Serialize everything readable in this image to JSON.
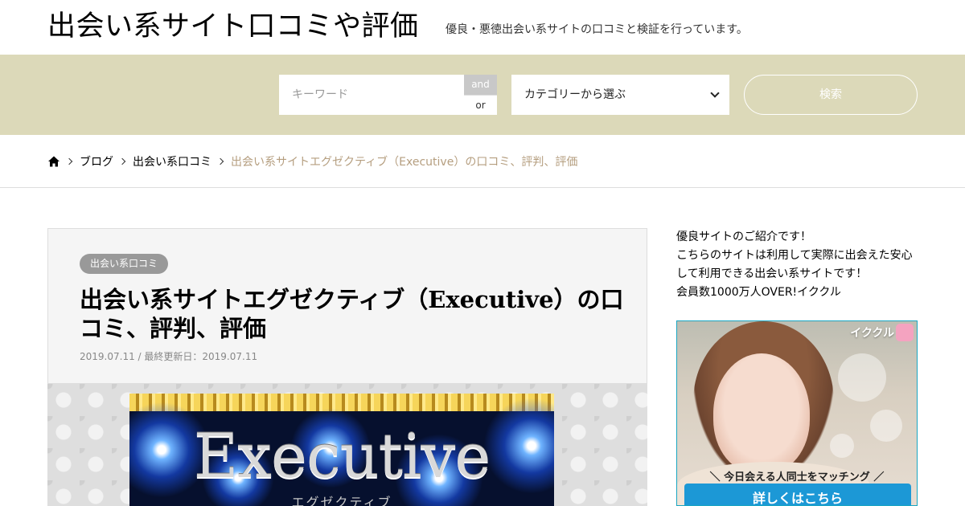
{
  "header": {
    "site_title": "出会い系サイト口コミや評価",
    "site_description": "優良・悪徳出会い系サイトの口コミと検証を行っています。"
  },
  "search": {
    "keyword_placeholder": "キーワード",
    "and_label": "and",
    "or_label": "or",
    "category_selected": "カテゴリーから選ぶ",
    "submit_label": "検索"
  },
  "breadcrumb": {
    "home_icon": "home-icon",
    "items": [
      "ブログ",
      "出会い系口コミ"
    ],
    "current": "出会い系サイトエグゼクティブ（Executive）の口コミ、評判、評価"
  },
  "article": {
    "category": "出会い系口コミ",
    "title": "出会い系サイトエグゼクティブ（Executive）の口コミ、評判、評価",
    "meta": "2019.07.11 / 最終更新日：2019.07.11",
    "featured_word": "Executive",
    "featured_sub": "エグゼクティブ"
  },
  "sidebar": {
    "intro_lines": [
      "優良サイトのご紹介です！",
      "こちらのサイトは利用して実際に出会えた安心",
      "して利用できる出会い系サイトです！",
      "会員数1000万人OVER!イククル"
    ],
    "ad": {
      "logo": "イククル",
      "tagline": "＼ 今日会える人同士をマッチング ／",
      "cta": "詳しくはこちら"
    }
  },
  "colors": {
    "search_band": "#dcd9b9",
    "breadcrumb_current": "#b59e7f",
    "badge": "#999999",
    "cta": "#1c98d6"
  }
}
